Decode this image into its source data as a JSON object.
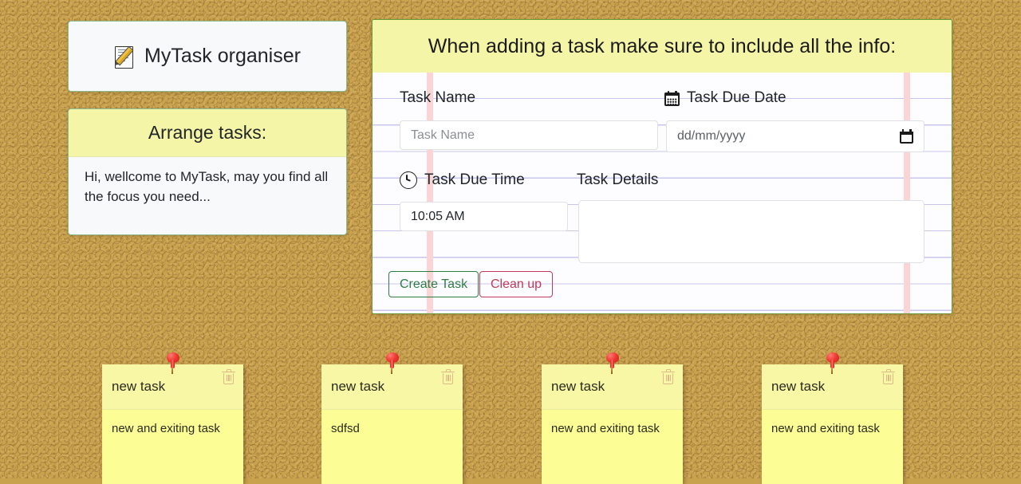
{
  "brand": {
    "icon": "memo-pencil-icon",
    "title": "MyTask organiser"
  },
  "arrange_card": {
    "header": "Arrange tasks:",
    "body": "Hi, wellcome to MyTask, may you find all the focus you need..."
  },
  "form": {
    "header": "When adding a task make sure to include all the info:",
    "fields": {
      "task_name": {
        "label": "Task Name",
        "placeholder": "Task Name",
        "value": ""
      },
      "task_due_date": {
        "label": "Task Due Date",
        "icon": "calendar-icon",
        "placeholder": "dd/mm/yyyy",
        "value": ""
      },
      "task_due_time": {
        "label": "Task Due Time",
        "icon": "clock-icon",
        "value": "10:05 AM"
      },
      "task_details": {
        "label": "Task Details",
        "value": ""
      }
    },
    "buttons": {
      "create": "Create Task",
      "clean": "Clean up"
    }
  },
  "notes": [
    {
      "title": "new task",
      "body": "new and exiting task",
      "pin": "pushpin-icon",
      "delete_icon": "trash-icon"
    },
    {
      "title": "new task",
      "body": "sdfsd",
      "pin": "pushpin-icon",
      "delete_icon": "trash-icon"
    },
    {
      "title": "new task",
      "body": "new and exiting task",
      "pin": "pushpin-icon",
      "delete_icon": "trash-icon"
    },
    {
      "title": "new task",
      "body": "new and exiting task",
      "pin": "pushpin-icon",
      "delete_icon": "trash-icon"
    }
  ],
  "colors": {
    "board": "#c9a24d",
    "sticky": "#fdfd96",
    "sticky_header": "#f7f7a6",
    "panel_border": "#6b9b37",
    "header_yellow": "#f5f5a8",
    "card_bg": "#f8f9fa",
    "card_border": "#8fbc8f",
    "rule_line": "#c9c6ee",
    "margin_line": "#fbd5d5",
    "create_btn": "#2e7d45",
    "clean_btn": "#c23a57",
    "pin_red": "#ef3b33",
    "trash_tan": "#e0b98a"
  }
}
